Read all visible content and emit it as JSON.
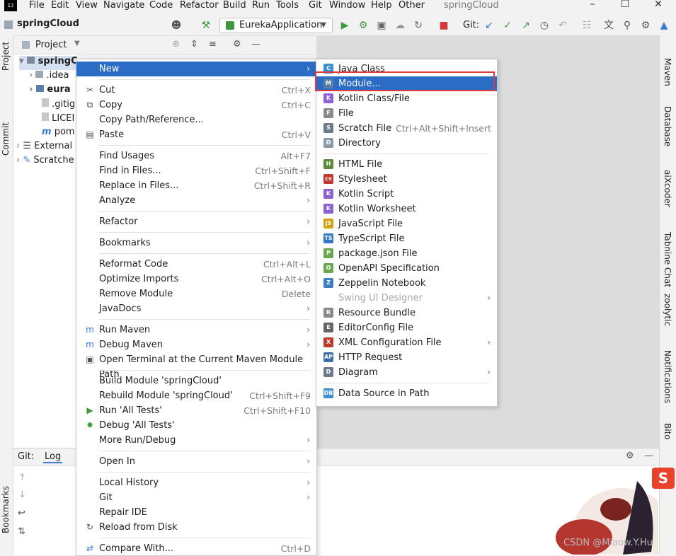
{
  "menubar": {
    "logo": "IJ",
    "items": [
      "File",
      "Edit",
      "View",
      "Navigate",
      "Code",
      "Refactor",
      "Build",
      "Run",
      "Tools",
      "Git",
      "Window",
      "Help",
      "Other"
    ],
    "window_title": "springCloud"
  },
  "toolbar": {
    "project_name": "springCloud",
    "run_config": "EurekaApplication",
    "git_label": "Git:"
  },
  "left_strip": {
    "project": "Project",
    "commit": "Commit",
    "bookmarks": "Bookmarks"
  },
  "right_strip": [
    "Maven",
    "Database",
    "aiXcoder",
    "Tabnine Chat",
    "zoolytic",
    "Notifications",
    "Bito"
  ],
  "project_panel": {
    "title": "Project",
    "tree": [
      "springC",
      ".idea",
      "eura",
      ".gitig",
      "LICEI",
      "pom",
      "External",
      "Scratche"
    ]
  },
  "git_panel": {
    "tab_git": "Git:",
    "tab_log": "Log"
  },
  "context_menu": [
    {
      "label": "New",
      "shortcut": "",
      "submenu": true,
      "selected": true,
      "icon": ""
    },
    {
      "sep": true
    },
    {
      "label": "Cut",
      "shortcut": "Ctrl+X",
      "icon": "cut-icon"
    },
    {
      "label": "Copy",
      "shortcut": "Ctrl+C",
      "icon": "copy-icon"
    },
    {
      "label": "Copy Path/Reference...",
      "shortcut": ""
    },
    {
      "label": "Paste",
      "shortcut": "Ctrl+V",
      "icon": "paste-icon"
    },
    {
      "sep": true
    },
    {
      "label": "Find Usages",
      "shortcut": "Alt+F7"
    },
    {
      "label": "Find in Files...",
      "shortcut": "Ctrl+Shift+F"
    },
    {
      "label": "Replace in Files...",
      "shortcut": "Ctrl+Shift+R"
    },
    {
      "label": "Analyze",
      "submenu": true
    },
    {
      "sep": true
    },
    {
      "label": "Refactor",
      "submenu": true
    },
    {
      "sep": true
    },
    {
      "label": "Bookmarks",
      "submenu": true
    },
    {
      "sep": true
    },
    {
      "label": "Reformat Code",
      "shortcut": "Ctrl+Alt+L"
    },
    {
      "label": "Optimize Imports",
      "shortcut": "Ctrl+Alt+O"
    },
    {
      "label": "Remove Module",
      "shortcut": "Delete"
    },
    {
      "label": "JavaDocs",
      "submenu": true
    },
    {
      "sep": true
    },
    {
      "label": "Run Maven",
      "submenu": true,
      "icon": "maven-run-icon"
    },
    {
      "label": "Debug Maven",
      "submenu": true,
      "icon": "maven-debug-icon"
    },
    {
      "label": "Open Terminal at the Current Maven Module Path",
      "icon": "terminal-icon"
    },
    {
      "sep": true
    },
    {
      "label": "Build Module 'springCloud'",
      "shortcut": ""
    },
    {
      "label": "Rebuild Module 'springCloud'",
      "shortcut": "Ctrl+Shift+F9"
    },
    {
      "label": "Run 'All Tests'",
      "shortcut": "Ctrl+Shift+F10",
      "icon": "run-icon"
    },
    {
      "label": "Debug 'All Tests'",
      "icon": "debug-icon"
    },
    {
      "label": "More Run/Debug",
      "submenu": true
    },
    {
      "sep": true
    },
    {
      "label": "Open In",
      "submenu": true
    },
    {
      "sep": true
    },
    {
      "label": "Local History",
      "submenu": true
    },
    {
      "label": "Git",
      "submenu": true
    },
    {
      "label": "Repair IDE"
    },
    {
      "label": "Reload from Disk",
      "icon": "reload-icon"
    },
    {
      "sep": true
    },
    {
      "label": "Compare With...",
      "shortcut": "Ctrl+D",
      "icon": "compare-icon"
    }
  ],
  "submenu": [
    {
      "label": "Java Class",
      "icon": "C",
      "color": "#3d8fd1"
    },
    {
      "label": "Module...",
      "icon": "M",
      "color": "#5a7ea6",
      "selected": true
    },
    {
      "label": "Kotlin Class/File",
      "icon": "K",
      "color": "#8a62d6"
    },
    {
      "label": "File",
      "icon": "F",
      "color": "#8a8a8a"
    },
    {
      "label": "Scratch File",
      "shortcut": "Ctrl+Alt+Shift+Insert",
      "icon": "S",
      "color": "#6c7a89"
    },
    {
      "label": "Directory",
      "icon": "D",
      "color": "#8e9aa6"
    },
    {
      "sep": true
    },
    {
      "label": "HTML File",
      "icon": "H",
      "color": "#5d8a3a"
    },
    {
      "label": "Stylesheet",
      "icon": "css",
      "color": "#c0392b"
    },
    {
      "label": "Kotlin Script",
      "icon": "K",
      "color": "#8a62d6"
    },
    {
      "label": "Kotlin Worksheet",
      "icon": "K",
      "color": "#8a62d6"
    },
    {
      "label": "JavaScript File",
      "icon": "JS",
      "color": "#d4a20d"
    },
    {
      "label": "TypeScript File",
      "icon": "TS",
      "color": "#3178c6"
    },
    {
      "label": "package.json File",
      "icon": "P",
      "color": "#6aa84f"
    },
    {
      "label": "OpenAPI Specification",
      "icon": "O",
      "color": "#6aa84f"
    },
    {
      "label": "Zeppelin Notebook",
      "icon": "Z",
      "color": "#3d7fc1"
    },
    {
      "label": "Swing UI Designer",
      "submenu": true,
      "disabled": true
    },
    {
      "label": "Resource Bundle",
      "icon": "R",
      "color": "#8a8a8a"
    },
    {
      "label": "EditorConfig File",
      "icon": "E",
      "color": "#666666"
    },
    {
      "label": "XML Configuration File",
      "submenu": true,
      "icon": "X",
      "color": "#c0392b"
    },
    {
      "label": "HTTP Request",
      "icon": "API",
      "color": "#3d6fa8"
    },
    {
      "label": "Diagram",
      "submenu": true,
      "icon": "D",
      "color": "#6c7a89"
    },
    {
      "sep": true
    },
    {
      "label": "Data Source in Path",
      "icon": "DB",
      "color": "#3d8fd1"
    }
  ],
  "watermark": "CSDN @Miaow.Y.Hu",
  "sogou": "S"
}
